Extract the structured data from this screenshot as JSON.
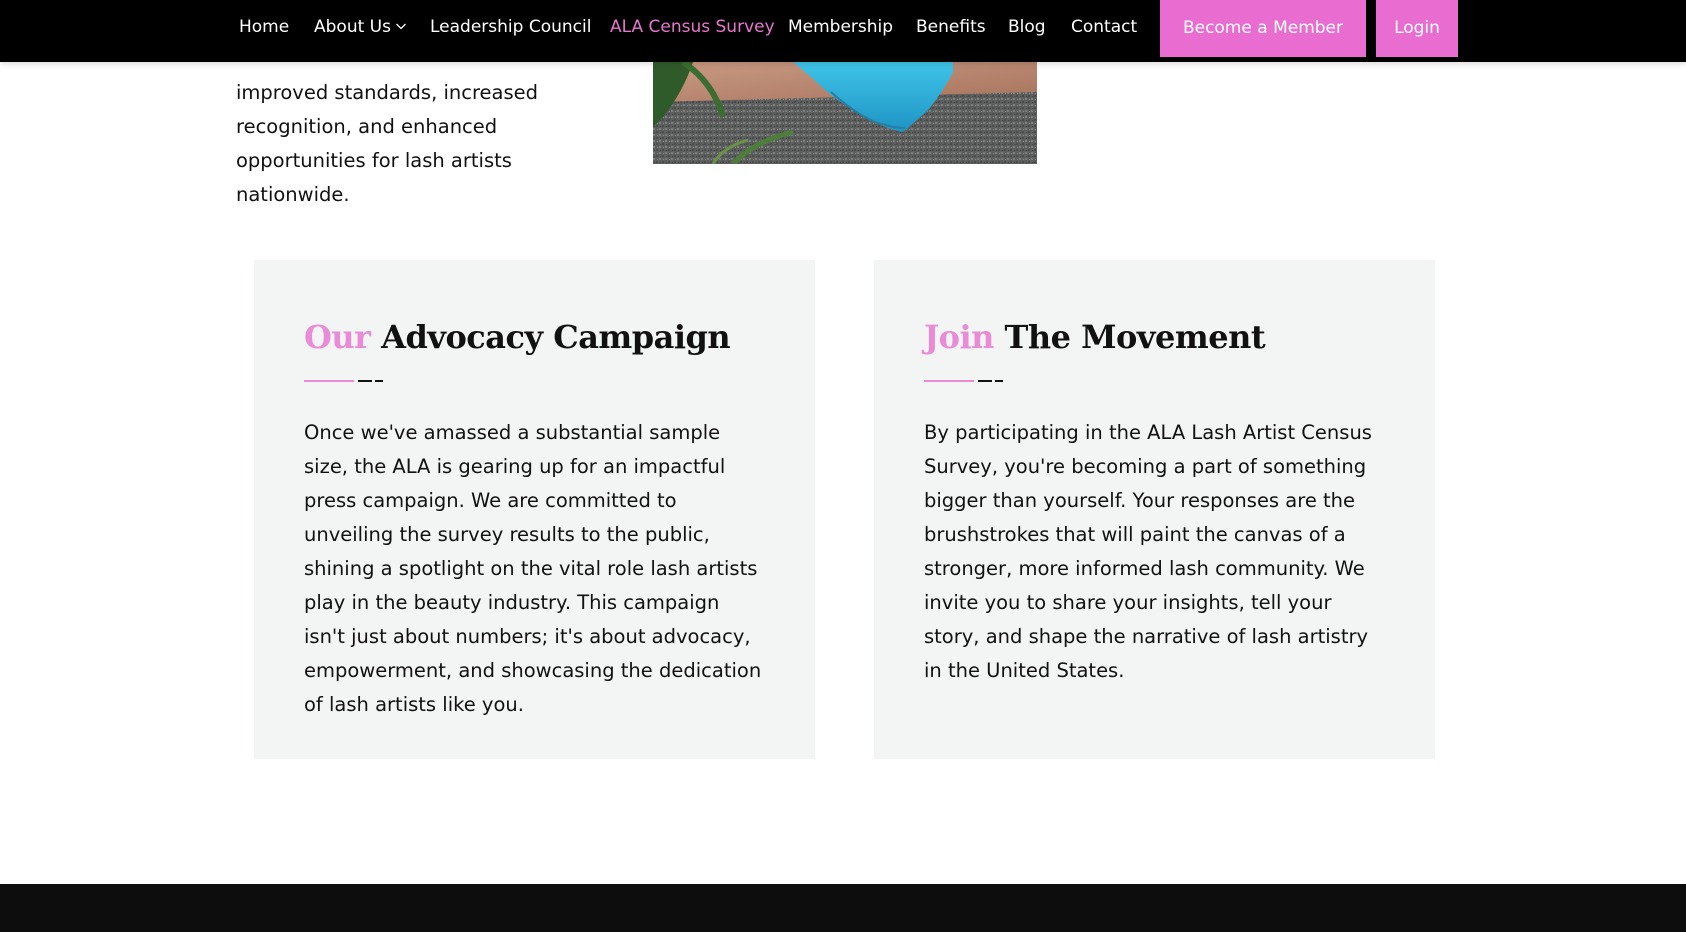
{
  "nav": {
    "items": [
      {
        "label": "Home",
        "active": false
      },
      {
        "label": "About Us",
        "active": false,
        "has_dropdown": true
      },
      {
        "label": "Leadership Council",
        "active": false
      },
      {
        "label": "ALA Census Survey",
        "active": true
      },
      {
        "label": "Membership",
        "active": false
      },
      {
        "label": "Benefits",
        "active": false
      },
      {
        "label": "Blog",
        "active": false
      },
      {
        "label": "Contact",
        "active": false
      }
    ],
    "become_member_label": "Become a Member",
    "login_label": "Login",
    "colors": {
      "background": "#000000",
      "active_link": "#e777cc",
      "button_bg": "#e96dd0"
    }
  },
  "intro": {
    "text": "improved standards, increased recognition, and enhanced opportunities for lash artists nationwide."
  },
  "cards": [
    {
      "title_accent": "Our",
      "title_rest": "Advocacy Campaign",
      "body": "Once we've amassed a substantial sample size, the ALA is gearing up for an impactful press campaign. We are committed to unveiling the survey results to the public, shining a spotlight on the vital role lash artists play in the beauty industry. This campaign isn't just about numbers; it's about advocacy, empowerment, and showcasing the dedication of lash artists like you."
    },
    {
      "title_accent": "Join",
      "title_rest": "The Movement",
      "body": "By participating in the ALA Lash Artist Census Survey, you're becoming a part of something bigger than yourself. Your responses are the brushstrokes that will paint the canvas of a stronger, more informed lash community. We invite you to share your insights, tell your story, and shape the narrative of lash artistry in the United States."
    }
  ],
  "colors": {
    "accent_pink": "#e98bd6",
    "card_background": "#f3f4f4",
    "footer_background": "#0d0d0d"
  }
}
